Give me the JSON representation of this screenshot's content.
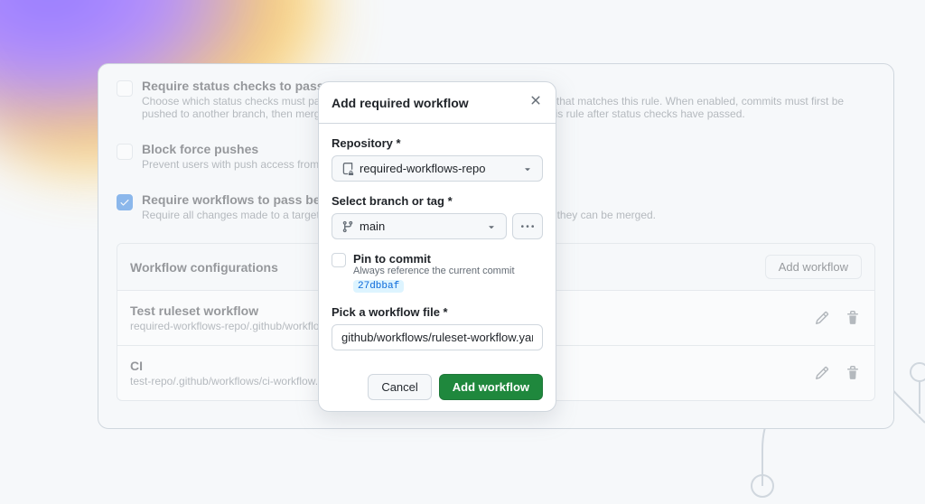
{
  "settings": {
    "status_checks": {
      "title": "Require status checks to pass before merging",
      "desc": "Choose which status checks must pass before branches can be merged into a branch that matches this rule. When enabled, commits must first be pushed to another branch, then merged or pushed directly to a branch that matches this rule after status checks have passed.",
      "checked": false
    },
    "force_pushes": {
      "title": "Block force pushes",
      "desc": "Prevent users with push access from force pushing to refs.",
      "checked": false
    },
    "require_workflows": {
      "title": "Require workflows to pass before merging",
      "desc": "Require all changes made to a targeted branch to pass the specified workflows before they can be merged.",
      "checked": true
    }
  },
  "wf_table": {
    "header": "Workflow configurations",
    "add_btn": "Add workflow",
    "rows": [
      {
        "title": "Test ruleset workflow",
        "path": "required-workflows-repo/.github/workflows/ruleset-workflow.yaml"
      },
      {
        "title": "CI",
        "path": "test-repo/.github/workflows/ci-workflow.yaml"
      }
    ]
  },
  "modal": {
    "title": "Add required workflow",
    "repo_label": "Repository *",
    "repo_value": "required-workflows-repo",
    "branch_label": "Select branch or tag *",
    "branch_value": "main",
    "pin_title": "Pin to commit",
    "pin_desc": "Always reference the current commit",
    "pin_sha": "27dbbaf",
    "file_label": "Pick a workflow file *",
    "file_value": "github/workflows/ruleset-workflow.yaml",
    "cancel": "Cancel",
    "submit": "Add workflow"
  }
}
